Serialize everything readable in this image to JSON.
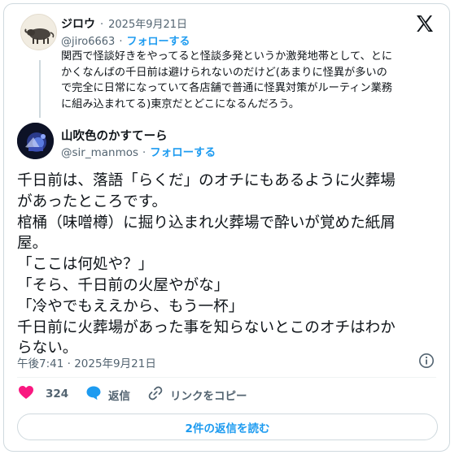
{
  "reply": {
    "display_name": "ジロウ",
    "date": "2025年9月21日",
    "handle": "@jiro6663",
    "follow_label": "フォローする",
    "lines": [
      "関西で怪談好きをやってると怪談多発というか激発地帯として、とに",
      "かくなんばの千日前は避けられないのだけど(あまりに怪異が多いの",
      "で完全に日常になっていて各店舗で普通に怪異対策がルーティン業務",
      "に組み込まれてる)東京だとどこになるんだろう。"
    ]
  },
  "main": {
    "display_name": "山吹色のかすてーら",
    "handle": "@sir_manmos",
    "follow_label": "フォローする",
    "lines": [
      "千日前は、落語「らくだ」のオチにもあるように火葬場",
      "があったところです。",
      "棺桶（味噌樽）に掘り込まれ火葬場で酔いが覚めた紙屑",
      "屋。",
      "「ここは何処や？」",
      "「そら、千日前の火屋やがな」",
      "「冷やでもええから、もう一杯」",
      "千日前に火葬場があった事を知らないとこのオチはわか",
      "らない。"
    ],
    "timestamp": "午後7:41 · 2025年9月21日"
  },
  "actions": {
    "like_count": "324",
    "reply_label": "返信",
    "copy_link_label": "リンクをコピー"
  },
  "read_replies_label": "2件の返信を読む",
  "colors": {
    "accent": "#1d9bf0",
    "like": "#f91880",
    "muted": "#536471"
  },
  "icons": [
    "x-logo-icon",
    "info-icon",
    "heart-icon",
    "reply-bubble-icon",
    "link-icon"
  ]
}
